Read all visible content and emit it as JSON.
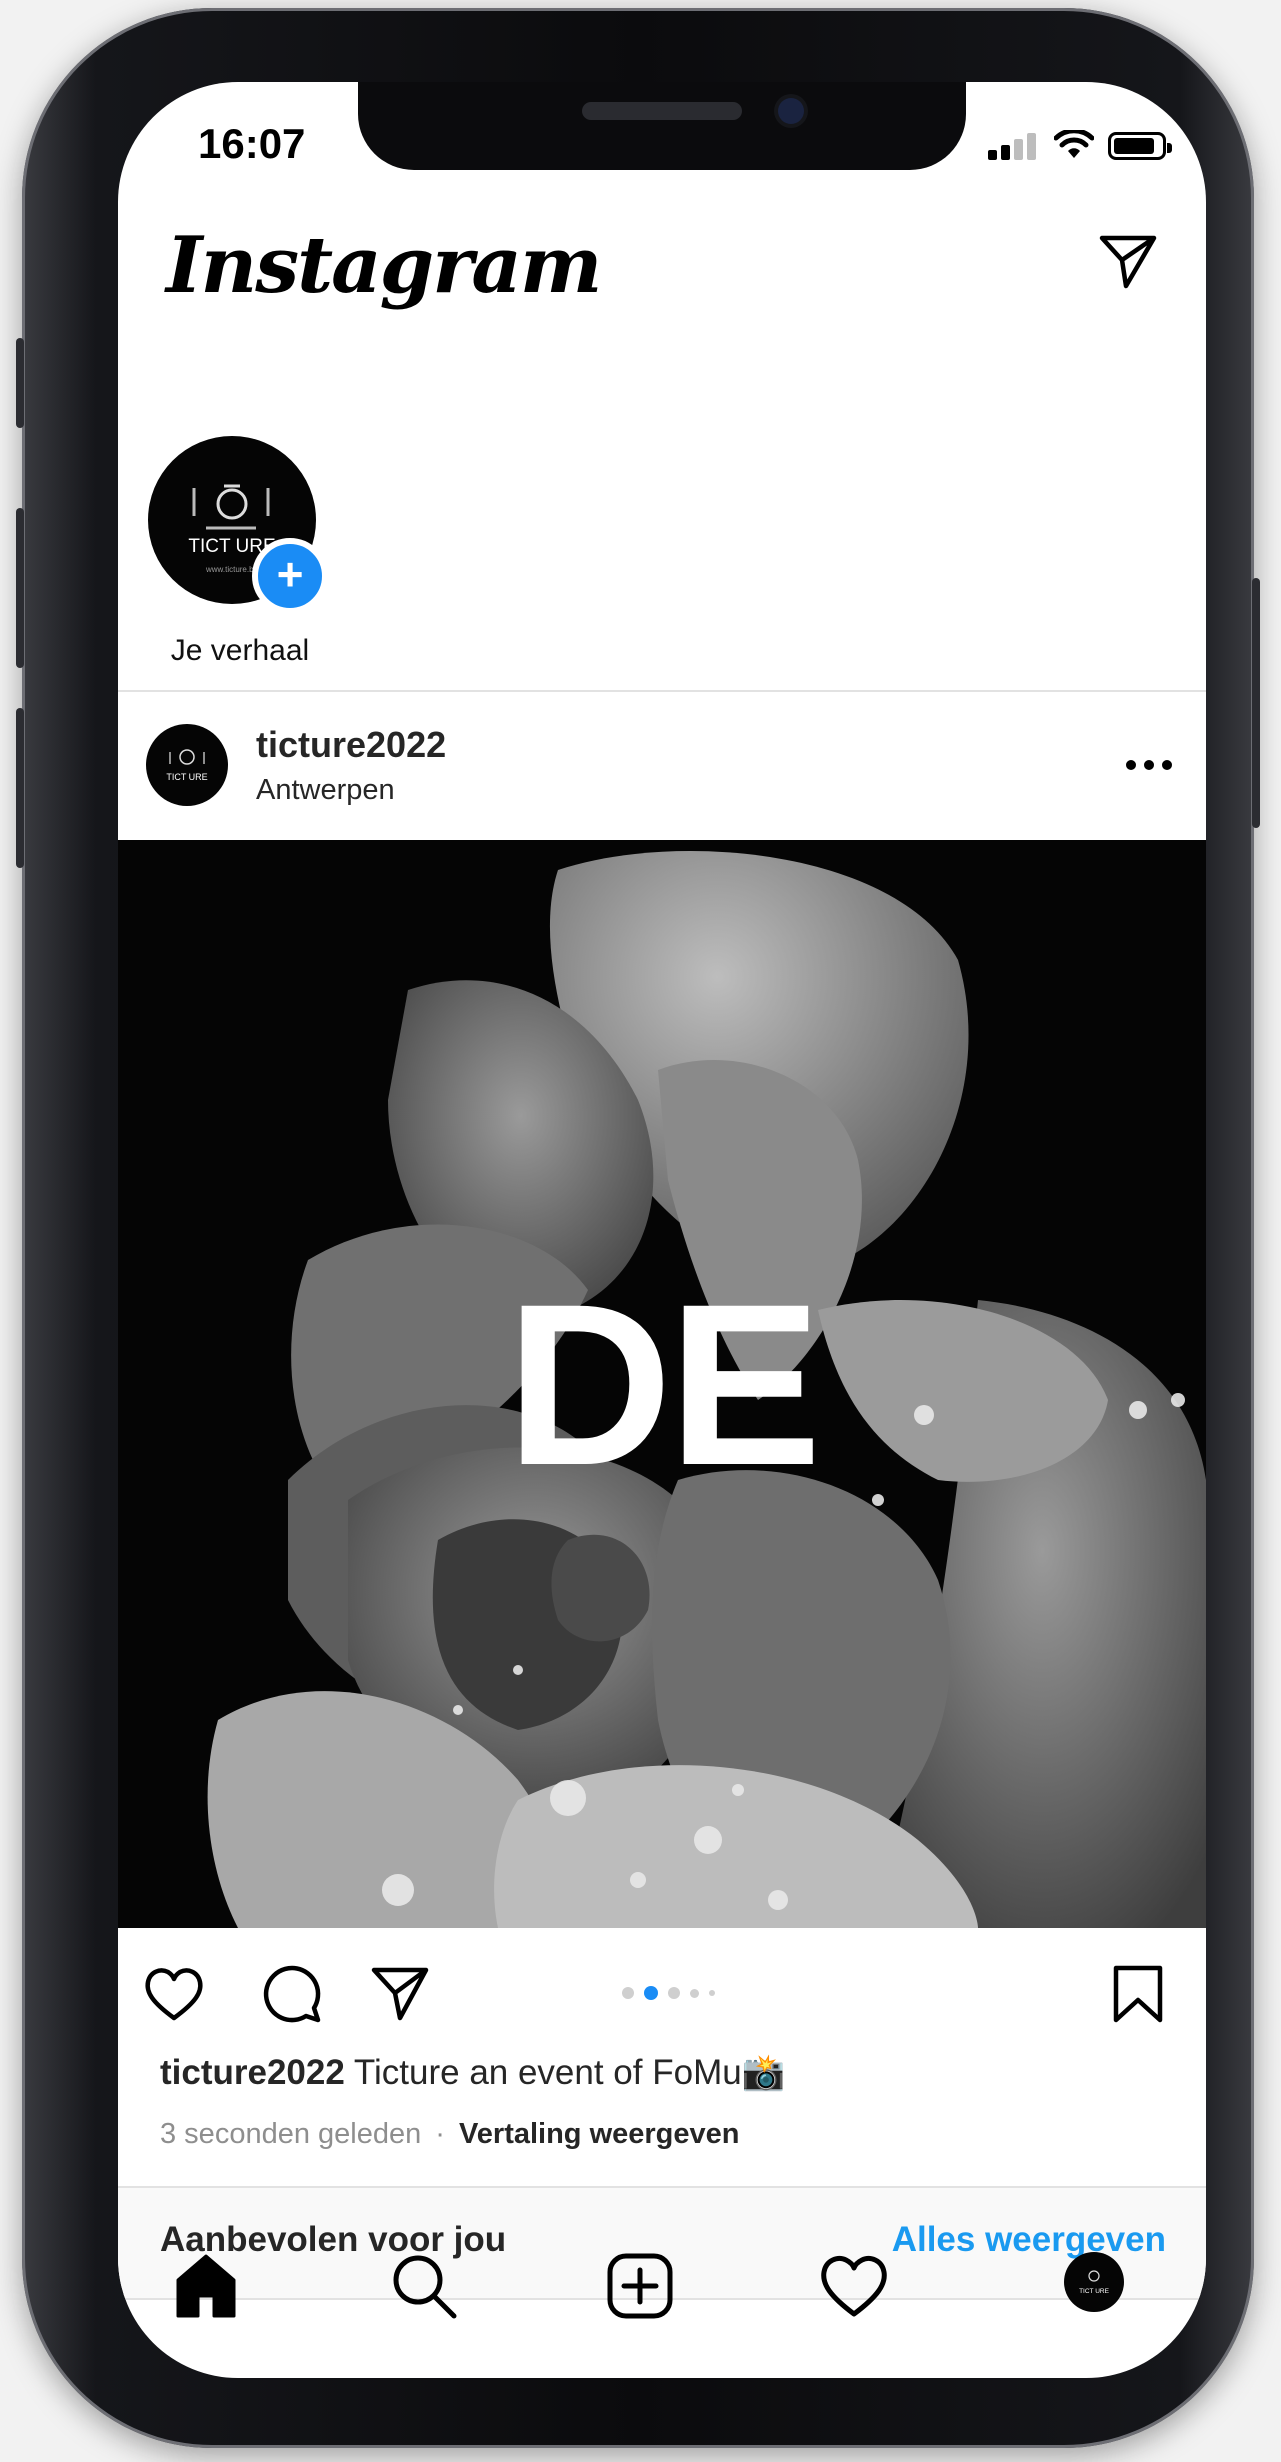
{
  "status_bar": {
    "time": "16:07"
  },
  "header": {
    "app_name": "Instagram"
  },
  "story": {
    "label": "Je verhaal",
    "avatar_text": "TICT URE",
    "avatar_subtext": "www.ticture.be"
  },
  "post": {
    "username": "ticture2022",
    "location": "Antwerpen",
    "image_text": "DE",
    "caption_user": "ticture2022",
    "caption_text": "Ticture an event of FoMu📸",
    "time_ago": "3 seconden geleden",
    "separator": "·",
    "translate_label": "Vertaling weergeven",
    "carousel": {
      "count": 5,
      "active_index": 1
    }
  },
  "recommended": {
    "title": "Aanbevolen voor jou",
    "link": "Alles weergeven"
  },
  "icons": [
    "send-icon",
    "heart-icon",
    "comment-icon",
    "bookmark-icon",
    "home-icon",
    "search-icon",
    "add-post-icon",
    "activity-icon",
    "more-icon"
  ],
  "colors": {
    "accent": "#1A8CF5",
    "link": "#1A9AF0"
  }
}
